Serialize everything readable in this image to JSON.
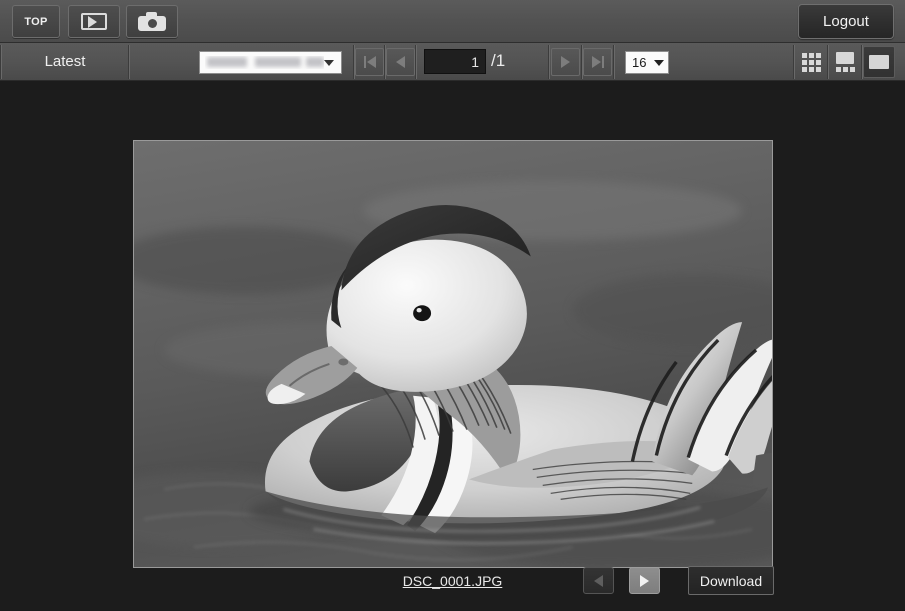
{
  "toolbar": {
    "top_label": "TOP",
    "movie_icon": "movie-icon",
    "camera_icon": "camera-icon",
    "logout_label": "Logout"
  },
  "subtoolbar": {
    "tab_label": "Latest",
    "folder_select": {
      "value": "",
      "redacted": true,
      "chevron_icon": "chevron-down-icon"
    },
    "pager": {
      "first_icon": "skip-to-first-icon",
      "prev_icon": "prev-arrow-icon",
      "page_value": "1",
      "page_total": "/1",
      "next_icon": "next-arrow-icon",
      "last_icon": "skip-to-last-icon"
    },
    "count_select": {
      "value": "16",
      "chevron_icon": "chevron-down-icon"
    },
    "views": {
      "grid_icon": "grid-view-icon",
      "filmstrip_icon": "filmstrip-view-icon",
      "single_icon": "single-view-icon",
      "active": "single"
    }
  },
  "viewer": {
    "image_alt": "grayscale photo of a mandarin duck swimming on water",
    "filename": "DSC_0001.JPG",
    "prev_icon": "prev-arrow-icon",
    "next_icon": "next-arrow-icon",
    "download_label": "Download"
  },
  "colors": {
    "toolbar_bg": "#535353",
    "content_bg": "#1c1c1c",
    "button_text": "#f0f0f0",
    "field_bg": "#fbfbfb"
  }
}
